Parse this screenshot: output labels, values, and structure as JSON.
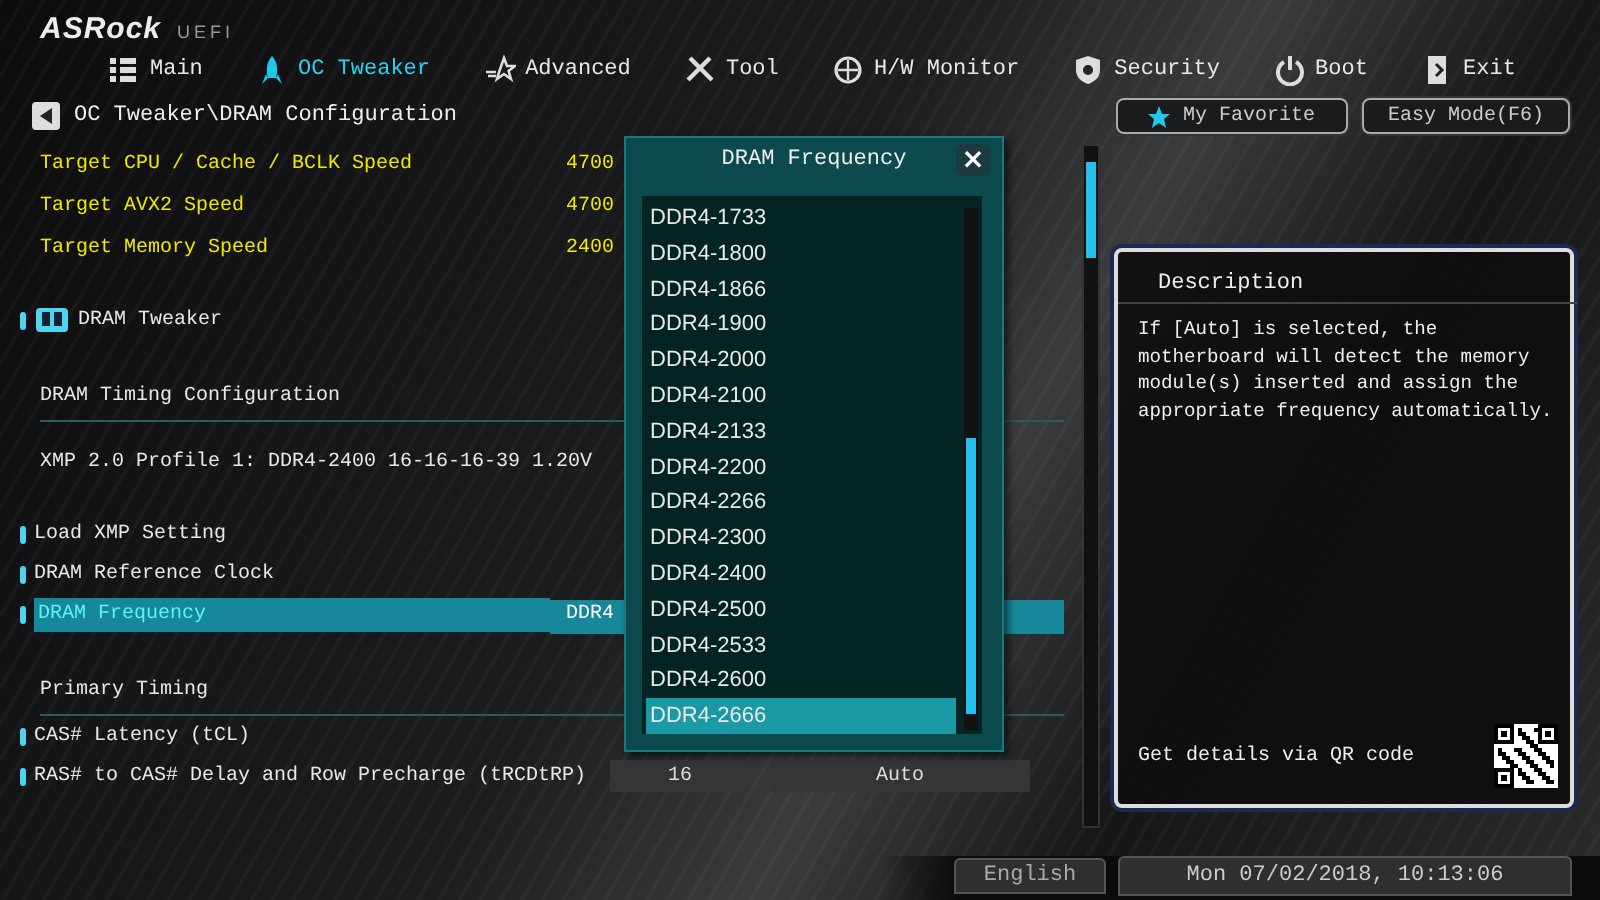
{
  "logo": {
    "brand": "ASRock",
    "suffix": "UEFI"
  },
  "tabs": [
    {
      "label": "Main",
      "selected": false
    },
    {
      "label": "OC Tweaker",
      "selected": true
    },
    {
      "label": "Advanced",
      "selected": false
    },
    {
      "label": "Tool",
      "selected": false
    },
    {
      "label": "H/W Monitor",
      "selected": false
    },
    {
      "label": "Security",
      "selected": false
    },
    {
      "label": "Boot",
      "selected": false
    },
    {
      "label": "Exit",
      "selected": false
    }
  ],
  "breadcrumb": "OC Tweaker\\DRAM Configuration",
  "favorite_button": "My Favorite",
  "easy_mode_button": "Easy Mode(F6)",
  "rows": [
    {
      "kind": "info",
      "label": "Target CPU / Cache / BCLK Speed",
      "value": "4700"
    },
    {
      "kind": "info",
      "label": "Target AVX2 Speed",
      "value": "4700"
    },
    {
      "kind": "info",
      "label": "Target Memory Speed",
      "value": "2400"
    },
    {
      "kind": "section",
      "label": "DRAM Tweaker"
    },
    {
      "kind": "heading",
      "label": "DRAM Timing Configuration"
    },
    {
      "kind": "text",
      "label": "XMP 2.0 Profile 1: DDR4-2400 16-16-16-39 1.20V"
    },
    {
      "kind": "setting",
      "label": "Load XMP Setting",
      "selected": false
    },
    {
      "kind": "setting",
      "label": "DRAM Reference Clock",
      "selected": false
    },
    {
      "kind": "setting",
      "label": "DRAM Frequency",
      "value": "DDR4",
      "selected": true
    },
    {
      "kind": "heading",
      "label": "Primary Timing"
    },
    {
      "kind": "setting",
      "label": "CAS# Latency (tCL)",
      "selected": false
    },
    {
      "kind": "setting",
      "label": "RAS# to CAS# Delay and Row Precharge (tRCDtRP)",
      "value": "16",
      "value_2": "Auto",
      "selected": false
    }
  ],
  "popup": {
    "title": "DRAM Frequency",
    "close": "×",
    "options": [
      {
        "label": "DDR4-1733",
        "selected": false
      },
      {
        "label": "DDR4-1800",
        "selected": false
      },
      {
        "label": "DDR4-1866",
        "selected": false
      },
      {
        "label": "DDR4-1900",
        "selected": false
      },
      {
        "label": "DDR4-2000",
        "selected": false
      },
      {
        "label": "DDR4-2100",
        "selected": false
      },
      {
        "label": "DDR4-2133",
        "selected": false
      },
      {
        "label": "DDR4-2200",
        "selected": false
      },
      {
        "label": "DDR4-2266",
        "selected": false
      },
      {
        "label": "DDR4-2300",
        "selected": false
      },
      {
        "label": "DDR4-2400",
        "selected": false
      },
      {
        "label": "DDR4-2500",
        "selected": false
      },
      {
        "label": "DDR4-2533",
        "selected": false
      },
      {
        "label": "DDR4-2600",
        "selected": false
      },
      {
        "label": "DDR4-2666",
        "selected": true
      }
    ]
  },
  "description": {
    "title": "Description",
    "text": "If [Auto] is selected, the motherboard will detect the memory module(s) inserted and assign the appropriate frequency automatically.",
    "qr_text": "Get details via QR code"
  },
  "status_bar": {
    "language": "English",
    "datetime": "Mon 07/02/2018, 10:13:06"
  }
}
